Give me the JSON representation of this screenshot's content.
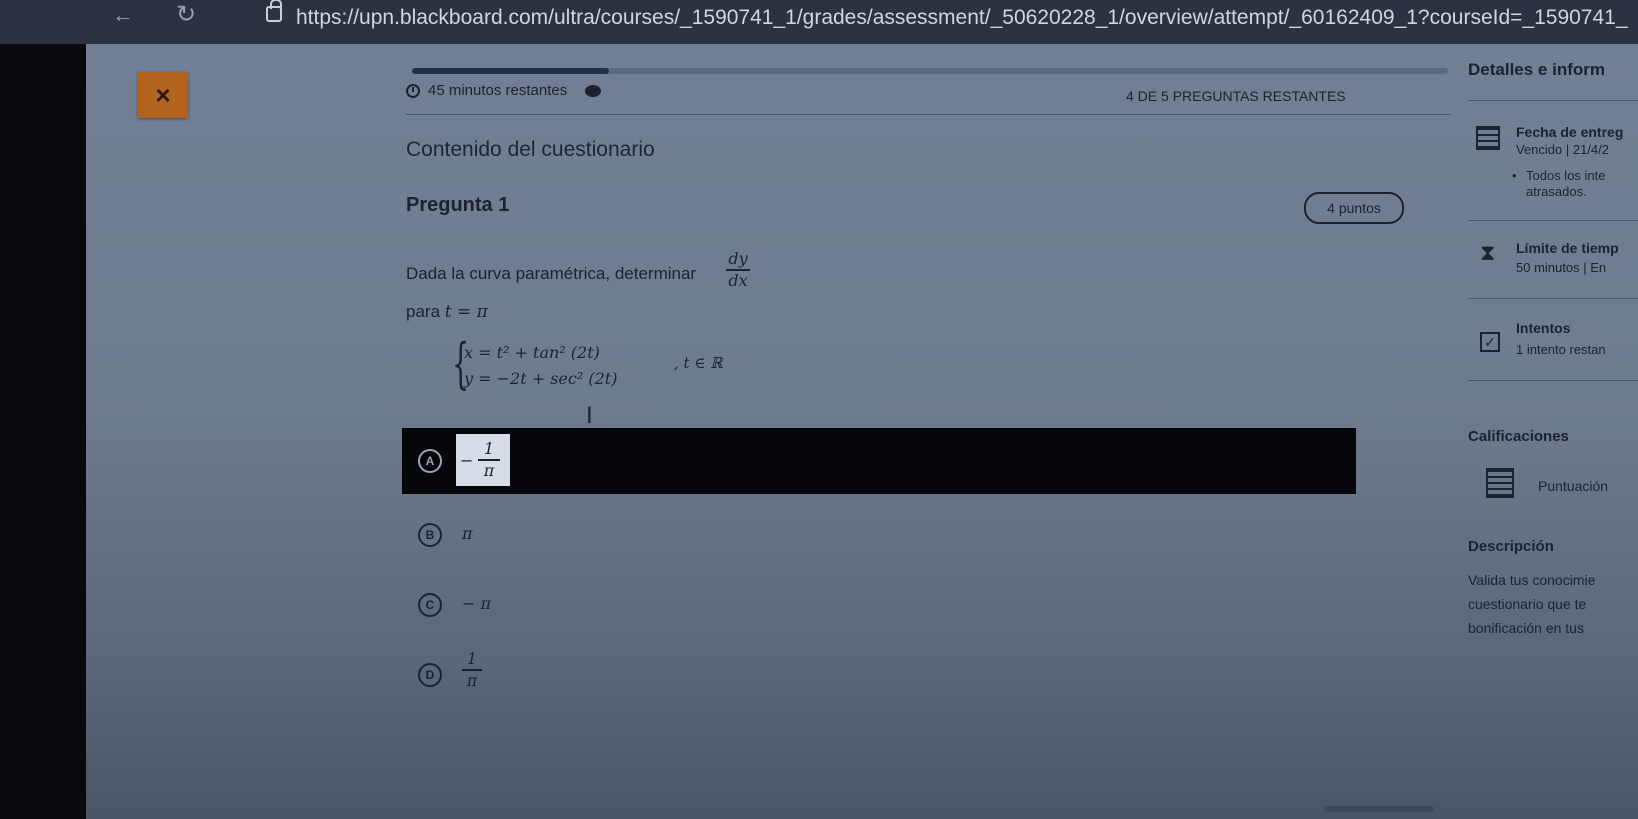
{
  "browser": {
    "url": "https://upn.blackboard.com/ultra/courses/_1590741_1/grades/assessment/_50620228_1/overview/attempt/_60162409_1?courseId=_1590741_",
    "back_glyph": "←",
    "reload_glyph": "↻"
  },
  "header": {
    "close_label": "×",
    "progress_fraction": 0.19,
    "timer_text": "45 minutos restantes",
    "remaining_questions": "4 DE 5 PREGUNTAS RESTANTES"
  },
  "quiz": {
    "section_title": "Contenido del cuestionario",
    "question_title": "Pregunta 1",
    "points": "4 puntos",
    "prompt": "Dada la curva paramétrica, determinar",
    "prompt_fraction": {
      "num": "dy",
      "den": "dx"
    },
    "for_label": "para",
    "for_math": "t = π",
    "equations": [
      "x = t² + tan² (2t)",
      "y = −2t + sec² (2t)"
    ],
    "domain_note": ", t ∈ ℝ",
    "answers": [
      {
        "letter": "A",
        "sign": "−",
        "num": "1",
        "den": "π",
        "selected": true
      },
      {
        "letter": "B",
        "text": "π",
        "selected": false
      },
      {
        "letter": "C",
        "text": "− π",
        "selected": false
      },
      {
        "letter": "D",
        "num": "1",
        "den": "π",
        "selected": false
      }
    ]
  },
  "sidebar": {
    "title": "Detalles e inform",
    "due_label": "Fecha de entreg",
    "due_value": "Vencido | 21/4/2",
    "due_bullet_1": "Todos los inte",
    "due_bullet_2": "atrasados.",
    "time_limit_label": "Límite de tiemp",
    "time_limit_value": "50 minutos | En",
    "attempts_label": "Intentos",
    "attempts_value": "1 intento restan",
    "grades_heading": "Calificaciones",
    "score_label": "Puntuación",
    "description_heading": "Descripción",
    "description_lines": [
      "Valida tus conocimie",
      "cuestionario que te",
      "bonificación en tus"
    ]
  }
}
